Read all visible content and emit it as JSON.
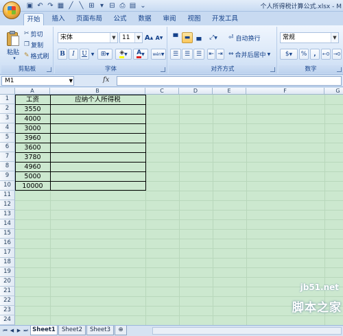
{
  "window": {
    "title": "个人所得税计算公式.xlsx - M"
  },
  "tabs": [
    "开始",
    "插入",
    "页面布局",
    "公式",
    "数据",
    "审阅",
    "视图",
    "开发工具"
  ],
  "ribbon": {
    "clipboard": {
      "paste": "粘贴",
      "cut": "剪切",
      "copy": "复制",
      "format_painter": "格式刷",
      "label": "剪贴板"
    },
    "font": {
      "name": "宋体",
      "size": "11",
      "grow": "A",
      "shrink": "A",
      "bold": "B",
      "italic": "I",
      "underline": "U",
      "color_a": "A",
      "wen": "wén",
      "label": "字体"
    },
    "alignment": {
      "wrap": "自动换行",
      "merge": "合并后居中",
      "label": "对齐方式"
    },
    "number": {
      "format": "常规",
      "percent": "%",
      "comma": ",",
      "label": "数字"
    }
  },
  "formula_bar": {
    "name_box": "M1",
    "fx": "fx",
    "content": ""
  },
  "sheet": {
    "columns": [
      "A",
      "B",
      "C",
      "D",
      "E",
      "F",
      "G"
    ],
    "rows": [
      "1",
      "2",
      "3",
      "4",
      "5",
      "6",
      "7",
      "8",
      "9",
      "10",
      "11",
      "12",
      "13",
      "14",
      "15",
      "16",
      "17",
      "18",
      "19",
      "20",
      "21",
      "22",
      "23",
      "24"
    ],
    "header_a": "工资",
    "header_b": "应纳个人所得税",
    "salaries": [
      "3550",
      "4000",
      "3000",
      "3960",
      "3600",
      "3780",
      "4960",
      "5000",
      "10000"
    ]
  },
  "sheet_tabs": [
    "Sheet1",
    "Sheet2",
    "Sheet3"
  ],
  "watermark": {
    "site": "jb51.net",
    "name": "脚本之家"
  }
}
